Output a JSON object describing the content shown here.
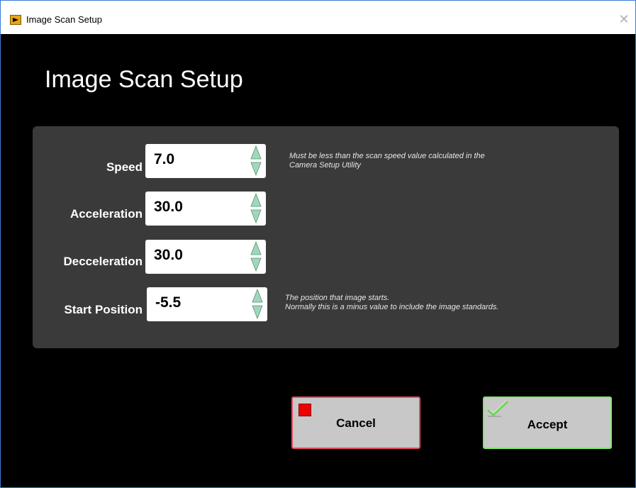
{
  "window": {
    "title": "Image Scan Setup",
    "app_icon": "labview-vi-icon",
    "close_glyph": "✕"
  },
  "heading": "Image Scan Setup",
  "fields": [
    {
      "label": "Speed",
      "value": "7.0"
    },
    {
      "label": "Acceleration",
      "value": "30.0"
    },
    {
      "label": "Decceleration",
      "value": "30.0"
    },
    {
      "label": "Start Position",
      "value": "-5.5"
    }
  ],
  "notes": {
    "speed": [
      "Must be less than the scan speed  value calculated in the",
      "Camera Setup Utility"
    ],
    "start_position": [
      "The position that image starts.",
      "Normally this is a minus value to include the image standards."
    ]
  },
  "buttons": {
    "cancel": {
      "label": "Cancel",
      "icon": "stop-icon",
      "border_color": "#e84a5f"
    },
    "accept": {
      "label": "Accept",
      "icon": "check-icon",
      "border_color": "#7fe86a"
    }
  },
  "colors": {
    "background": "#000000",
    "panel": "#3a3a3a",
    "spinner": "#9fd8b8",
    "stop_red": "#ee0000"
  }
}
